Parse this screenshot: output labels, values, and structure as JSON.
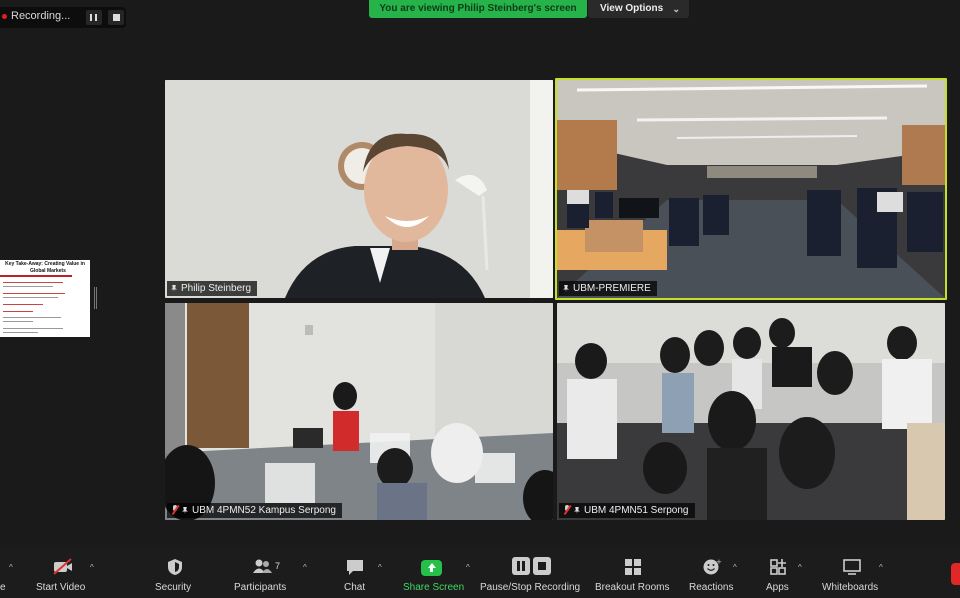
{
  "recording": {
    "label": "Recording..."
  },
  "banner": {
    "viewing_text": "You are viewing Philip Steinberg's screen",
    "view_options_label": "View Options"
  },
  "shared_thumbnail": {
    "title": "Key Take-Away: Creating Value in",
    "title2": "Global Markets"
  },
  "participants": [
    {
      "name": "Philip Steinberg",
      "muted": false,
      "pinned": true
    },
    {
      "name": "UBM-PREMIERE",
      "muted": false,
      "pinned": true,
      "active_speaker": true
    },
    {
      "name": "UBM 4PMN52 Kampus Serpong",
      "muted": true,
      "pinned": true
    },
    {
      "name": "UBM 4PMN51 Serpong",
      "muted": true,
      "pinned": true
    }
  ],
  "toolbar": {
    "partial_left": "e",
    "start_video": "Start Video",
    "security": "Security",
    "participants": "Participants",
    "participants_count": "7",
    "chat": "Chat",
    "share_screen": "Share Screen",
    "pause_stop_recording": "Pause/Stop Recording",
    "breakout_rooms": "Breakout Rooms",
    "reactions": "Reactions",
    "apps": "Apps",
    "whiteboards": "Whiteboards"
  },
  "colors": {
    "accent_green": "#25b34a",
    "active_speaker": "#c4e02c",
    "end_red": "#e02828"
  }
}
